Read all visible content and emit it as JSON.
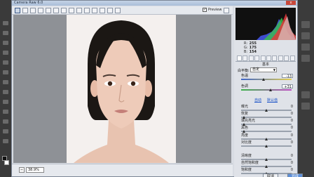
{
  "window": {
    "title": "Camera Raw 6.0",
    "close_label": "x"
  },
  "toolbar": {
    "tools": [
      "zoom-tool-icon",
      "hand-tool-icon",
      "white-balance-tool-icon",
      "color-sampler-icon",
      "target-adjustment-icon",
      "crop-tool-icon",
      "straighten-tool-icon",
      "spot-removal-icon",
      "red-eye-icon",
      "adjustment-brush-icon",
      "graduated-filter-icon",
      "preferences-icon",
      "rotate-ccw-icon",
      "rotate-cw-icon"
    ],
    "preview_label": "Preview",
    "preview_checked": "✓"
  },
  "status": {
    "zoom_out": "−",
    "zoom_value": "38.9%"
  },
  "panel": {
    "rgb": {
      "r_label": "R:",
      "r": "255",
      "g_label": "G:",
      "g": "175",
      "b_label": "B:",
      "b": "154"
    },
    "section_title": "基本",
    "white_balance_label": "白平衡:",
    "white_balance_value": "自定",
    "auto_link": "自动",
    "default_link": "默认值",
    "sliders": [
      {
        "label": "色温",
        "value": "-13",
        "pos": 0.45
      },
      {
        "label": "色调",
        "value": "+31",
        "pos": 0.58
      },
      {
        "label": "曝光",
        "value": "0",
        "pos": 0.5
      },
      {
        "label": "恢复",
        "value": "0",
        "pos": 0.05
      },
      {
        "label": "填充亮光",
        "value": "0",
        "pos": 0.05
      },
      {
        "label": "黑色",
        "value": "0",
        "pos": 0.05
      },
      {
        "label": "亮度",
        "value": "0",
        "pos": 0.5
      },
      {
        "label": "对比度",
        "value": "0",
        "pos": 0.5
      },
      {
        "label": "清晰度",
        "value": "0",
        "pos": 0.5
      },
      {
        "label": "自然饱和度",
        "value": "0",
        "pos": 0.5
      },
      {
        "label": "饱和度",
        "value": "0",
        "pos": 0.5
      }
    ],
    "cancel_label": "取消",
    "ok_label": "完成"
  },
  "colors": {
    "accent": "#5d8fd8",
    "link": "#1a52c7",
    "dialog_bg": "#d8dce3"
  }
}
